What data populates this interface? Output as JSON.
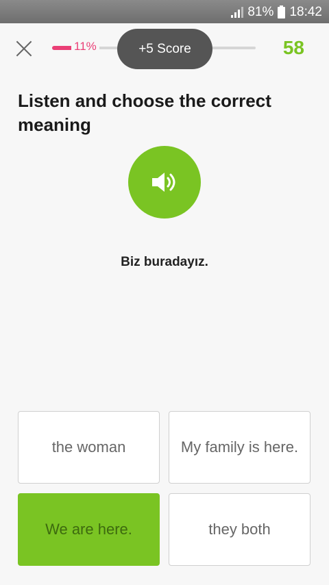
{
  "status_bar": {
    "battery": "81%",
    "time": "18:42",
    "icons": [
      "signal-icon",
      "battery-icon"
    ]
  },
  "header": {
    "progress_percent": 11,
    "progress_label": "11%",
    "score_toast": "+5 Score",
    "score": "58",
    "icons": [
      "close-icon"
    ]
  },
  "lesson": {
    "prompt": "Listen and choose the correct meaning",
    "audio_icon": "speaker-icon",
    "phrase": "Biz buradayız.",
    "options": [
      {
        "label": "the woman",
        "selected": false
      },
      {
        "label": "My family is here.",
        "selected": false
      },
      {
        "label": "We are here.",
        "selected": true
      },
      {
        "label": "they both",
        "selected": false
      }
    ]
  },
  "colors": {
    "accent_green": "#7ac423",
    "progress_pink": "#ea3f76",
    "toast_dark": "#555555"
  }
}
